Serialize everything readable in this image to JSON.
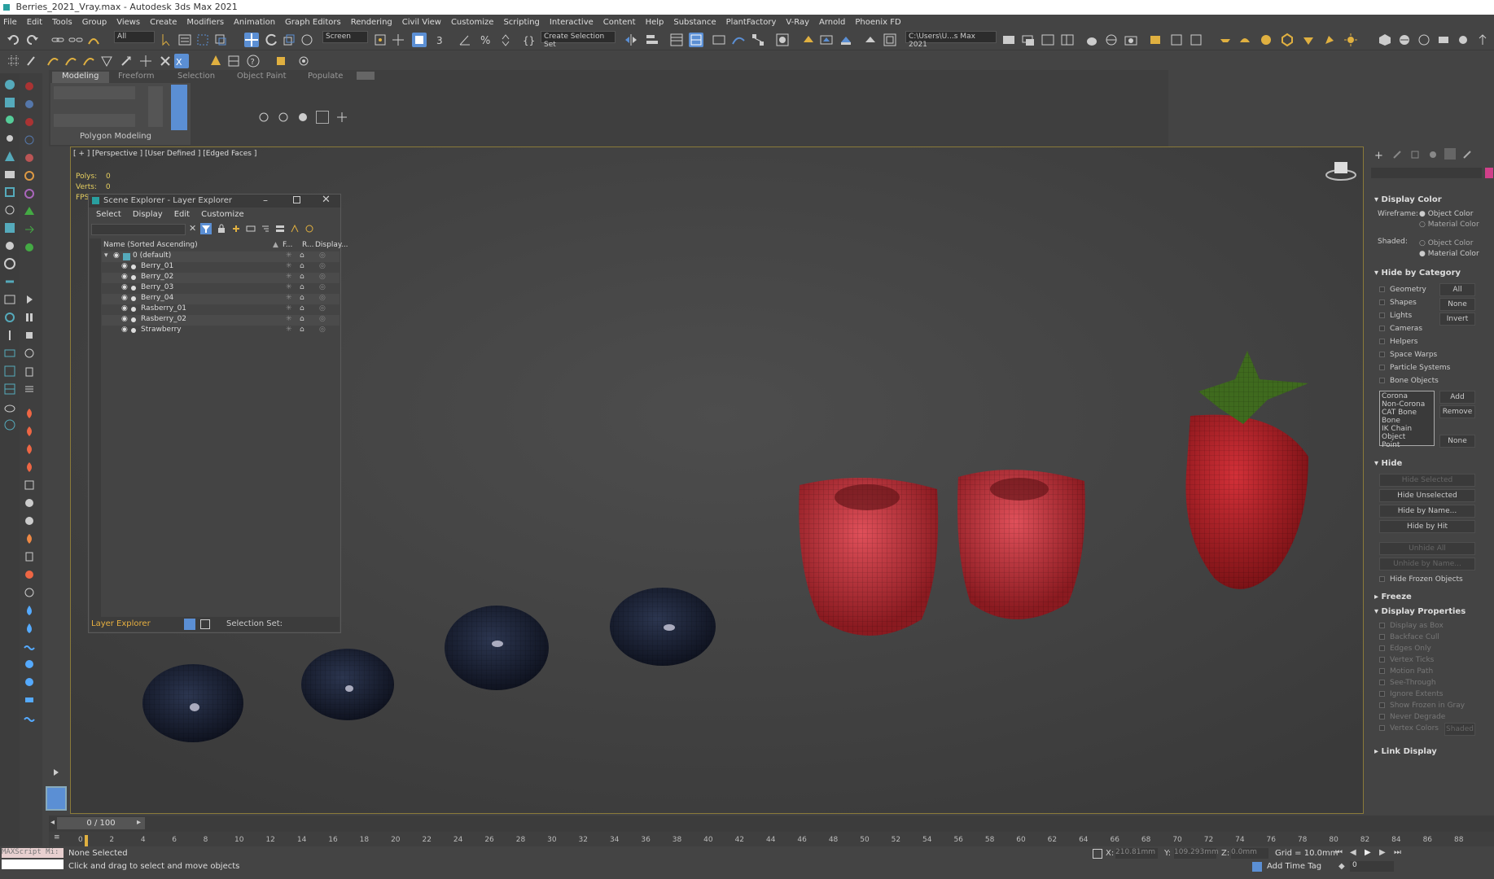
{
  "window": {
    "title": "Berries_2021_Vray.max - Autodesk 3ds Max 2021"
  },
  "menu": [
    "File",
    "Edit",
    "Tools",
    "Group",
    "Views",
    "Create",
    "Modifiers",
    "Animation",
    "Graph Editors",
    "Rendering",
    "Civil View",
    "Customize",
    "Scripting",
    "Interactive",
    "Content",
    "Help",
    "Substance",
    "PlantFactory",
    "V-Ray",
    "Arnold",
    "Phoenix FD"
  ],
  "toolbar": {
    "selection_filter": "All",
    "ref_coord": "Screen",
    "selection_set": "Create Selection Set",
    "project_path": "C:\\Users\\U...s Max 2021"
  },
  "ribbon": {
    "tabs": [
      "Modeling",
      "Freeform",
      "Selection",
      "Object Paint",
      "Populate"
    ],
    "panel_label": "Polygon Modeling"
  },
  "viewport": {
    "label": "[ + ] [Perspective ] [User Defined ] [Edged Faces ]",
    "polys_label": "Polys:",
    "polys_value": "0",
    "verts_label": "Verts:",
    "verts_value": "0",
    "fps_label": "FPS"
  },
  "explorer": {
    "title": "Scene Explorer - Layer Explorer",
    "menu": [
      "Select",
      "Display",
      "Edit",
      "Customize"
    ],
    "col_name": "Name (Sorted Ascending)",
    "col_f": "F...",
    "col_r": "R...",
    "col_display": "Display...",
    "root": "0 (default)",
    "items": [
      "Berry_01",
      "Berry_02",
      "Berry_03",
      "Berry_04",
      "Rasberry_01",
      "Rasberry_02",
      "Strawberry"
    ],
    "footer_mode": "Layer Explorer",
    "footer_selset": "Selection Set:"
  },
  "cmdpanel": {
    "display_color": {
      "title": "Display Color",
      "wire_label": "Wireframe:",
      "shaded_label": "Shaded:",
      "opt_object": "Object Color",
      "opt_material": "Material Color"
    },
    "hide_by_category": {
      "title": "Hide by Category",
      "items": [
        "Geometry",
        "Shapes",
        "Lights",
        "Cameras",
        "Helpers",
        "Space Warps",
        "Particle Systems",
        "Bone Objects"
      ],
      "btn_all": "All",
      "btn_none": "None",
      "btn_invert": "Invert",
      "list": [
        "Corona",
        "Non-Corona",
        "CAT Bone",
        "Bone",
        "IK Chain Object",
        "Point"
      ],
      "btn_add": "Add",
      "btn_remove": "Remove",
      "btn_none2": "None"
    },
    "hide": {
      "title": "Hide",
      "buttons": [
        "Hide Selected",
        "Hide Unselected",
        "Hide by Name...",
        "Hide by Hit",
        "Unhide All",
        "Unhide by Name..."
      ],
      "frozen": "Hide Frozen Objects"
    },
    "freeze": {
      "title": "Freeze"
    },
    "display_properties": {
      "title": "Display Properties",
      "items": [
        "Display as Box",
        "Backface Cull",
        "Edges Only",
        "Vertex Ticks",
        "Motion Path",
        "See-Through",
        "Ignore Extents",
        "Show Frozen in Gray",
        "Never Degrade",
        "Vertex Colors"
      ],
      "shaded_btn": "Shaded"
    },
    "link_display": {
      "title": "Link Display"
    }
  },
  "timeline": {
    "frame": "0 / 100",
    "ticks": [
      "0",
      "2",
      "4",
      "6",
      "8",
      "10",
      "12",
      "14",
      "16",
      "18",
      "20",
      "22",
      "24",
      "26",
      "28",
      "30",
      "32",
      "34",
      "36",
      "38",
      "40",
      "42",
      "44",
      "46",
      "48",
      "50",
      "52",
      "54",
      "56",
      "58",
      "60",
      "62",
      "64",
      "66",
      "68",
      "70",
      "72",
      "74",
      "76",
      "78",
      "80",
      "82",
      "84",
      "86",
      "88"
    ]
  },
  "status": {
    "maxscript": "MAXScript Mi:",
    "selection": "None Selected",
    "prompt": "Click and drag to select and move objects",
    "x_label": "X:",
    "x_value": "210.81mm",
    "y_label": "Y:",
    "y_value": "109.293mm",
    "z_label": "Z:",
    "z_value": "0.0mm",
    "grid": "Grid = 10.0mm",
    "add_time_tag": "Add Time Tag",
    "spinner": "0"
  },
  "colors": {
    "accent": "#5b8fd4",
    "viewport_border": "#8a7a3a",
    "stats": "#e8d060",
    "layer_footer": "#e8b040",
    "strawberry": "#b0242a",
    "blueberry": "#1a2438"
  }
}
